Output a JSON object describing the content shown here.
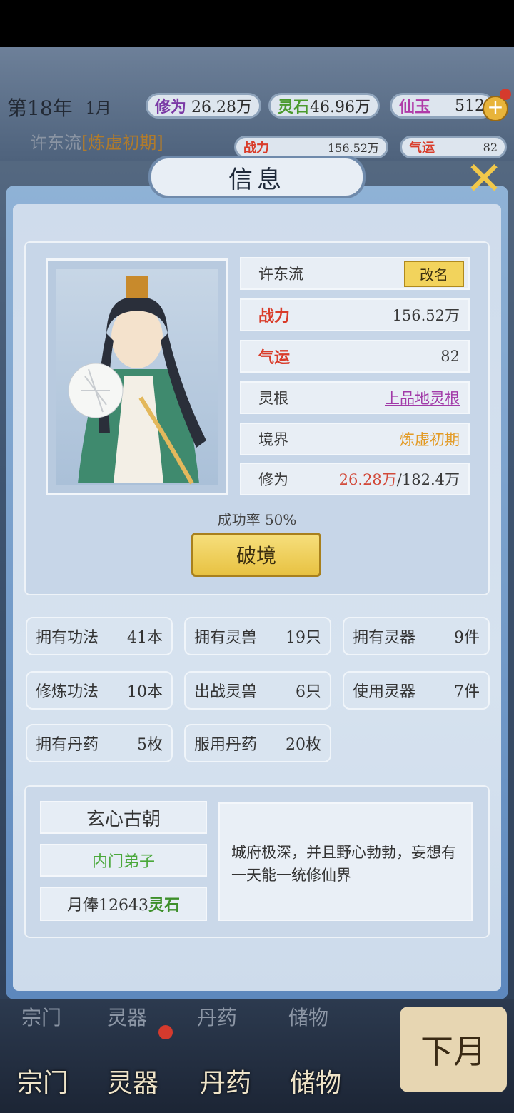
{
  "top": {
    "year": "第18年",
    "month": "1月",
    "resources": [
      {
        "label": "修为",
        "value": "26.28万"
      },
      {
        "label": "灵石",
        "value": "46.96万"
      },
      {
        "label": "仙玉",
        "value": "512"
      }
    ],
    "plus": "+",
    "behind_name": "许东流",
    "behind_realm": "[炼虚初期]",
    "behind_stats": [
      {
        "label": "战力",
        "value": "156.52万"
      },
      {
        "label": "气运",
        "value": "82"
      }
    ]
  },
  "dialog": {
    "title": "信息",
    "close": "✕",
    "profile": {
      "name": "许东流",
      "rename": "改名",
      "power_label": "战力",
      "power": "156.52万",
      "luck_label": "气运",
      "luck": "82",
      "root_label": "灵根",
      "root": "上品地灵根",
      "realm_label": "境界",
      "realm": "炼虚初期",
      "cult_label": "修为",
      "cult_current": "26.28万",
      "cult_total": "/182.4万"
    },
    "success_rate": "成功率 50%",
    "breakthrough": "破境",
    "stats": [
      {
        "label": "拥有功法",
        "value": "41本"
      },
      {
        "label": "拥有灵兽",
        "value": "19只"
      },
      {
        "label": "拥有灵器",
        "value": "9件"
      },
      {
        "label": "修炼功法",
        "value": "10本"
      },
      {
        "label": "出战灵兽",
        "value": "6只"
      },
      {
        "label": "使用灵器",
        "value": "7件"
      },
      {
        "label": "拥有丹药",
        "value": "5枚"
      },
      {
        "label": "服用丹药",
        "value": "20枚"
      }
    ],
    "sect": {
      "name": "玄心古朝",
      "rank": "内门弟子",
      "salary_prefix": "月俸12643",
      "salary_unit": "灵石",
      "description": "城府极深，并且野心勃勃，妄想有一天能一统修仙界"
    }
  },
  "bottom": {
    "tabs_top": [
      "宗门",
      "灵器",
      "丹药",
      "储物"
    ],
    "tabs": [
      "宗门",
      "灵器",
      "丹药",
      "储物"
    ],
    "next_month": "下月"
  }
}
